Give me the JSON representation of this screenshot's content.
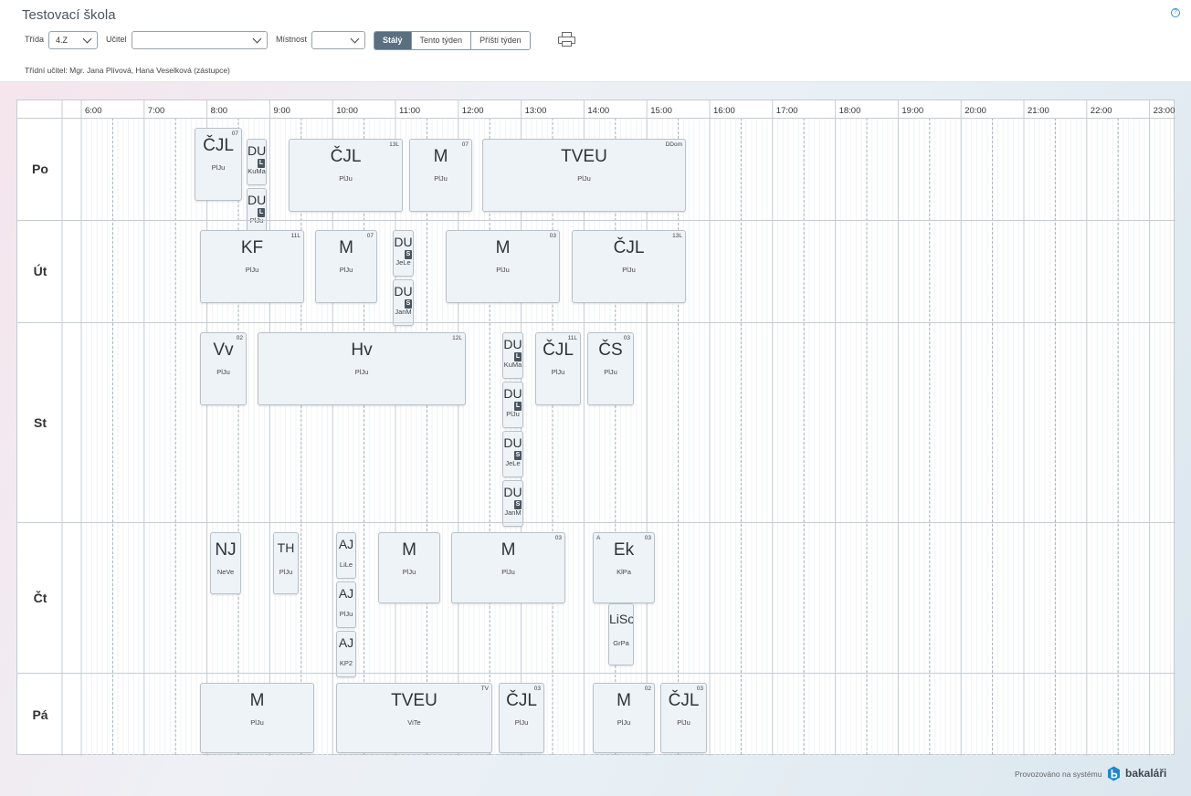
{
  "school_name": "Testovací škola",
  "help_label": "?",
  "filters": {
    "class_label": "Třída",
    "class_value": "4.Z",
    "teacher_label": "Učitel",
    "teacher_value": "",
    "room_label": "Místnost",
    "room_value": ""
  },
  "week_buttons": [
    "Stálý",
    "Tento týden",
    "Příští týden"
  ],
  "active_week": "Stálý",
  "class_teacher": "Třídní učitel: Mgr. Jana Plívová, Hana Veselková (zástupce)",
  "hours": [
    "6:00",
    "7:00",
    "8:00",
    "9:00",
    "10:00",
    "11:00",
    "12:00",
    "13:00",
    "14:00",
    "15:00",
    "16:00",
    "17:00",
    "18:00",
    "19:00",
    "20:00",
    "21:00",
    "22:00",
    "23:00"
  ],
  "days": [
    {
      "name": "Po",
      "lessons": [
        {
          "subject": "ČJL",
          "teacher": "PlJu",
          "room": "07"
        },
        {
          "subject": "DU",
          "teacher": "KuMa",
          "badge": "L"
        },
        {
          "subject": "DU",
          "teacher": "PlJu",
          "badge": "L"
        },
        {
          "subject": "ČJL",
          "teacher": "PlJu",
          "room": "13L"
        },
        {
          "subject": "M",
          "teacher": "PlJu",
          "room": "07"
        },
        {
          "subject": "TVEU",
          "teacher": "PlJu",
          "room": "DDom"
        }
      ]
    },
    {
      "name": "Út",
      "lessons": [
        {
          "subject": "KF",
          "teacher": "PlJu",
          "room": "11L"
        },
        {
          "subject": "M",
          "teacher": "PlJu",
          "room": "07"
        },
        {
          "subject": "DU",
          "teacher": "JeLe",
          "badge": "S"
        },
        {
          "subject": "DU",
          "teacher": "JanM",
          "badge": "S"
        },
        {
          "subject": "M",
          "teacher": "PlJu",
          "room": "03"
        },
        {
          "subject": "ČJL",
          "teacher": "PlJu",
          "room": "13L"
        }
      ]
    },
    {
      "name": "St",
      "lessons": [
        {
          "subject": "Vv",
          "teacher": "PlJu",
          "room": "02"
        },
        {
          "subject": "Hv",
          "teacher": "PlJu",
          "room": "12L"
        },
        {
          "subject": "DU",
          "teacher": "KuMa",
          "badge": "L"
        },
        {
          "subject": "DU",
          "teacher": "PlJu",
          "badge": "L"
        },
        {
          "subject": "DU",
          "teacher": "JeLe",
          "badge": "S"
        },
        {
          "subject": "DU",
          "teacher": "JanM",
          "badge": "S"
        },
        {
          "subject": "ČJL",
          "teacher": "PlJu",
          "room": "11L"
        },
        {
          "subject": "ČS",
          "teacher": "PlJu",
          "room": "03"
        }
      ]
    },
    {
      "name": "Čt",
      "lessons": [
        {
          "subject": "NJ",
          "teacher": "NeVe"
        },
        {
          "subject": "TH",
          "teacher": "PlJu"
        },
        {
          "subject": "AJ",
          "teacher": "LiLe"
        },
        {
          "subject": "AJ",
          "teacher": "PlJu"
        },
        {
          "subject": "AJ",
          "teacher": "KP2"
        },
        {
          "subject": "M",
          "teacher": "PlJu"
        },
        {
          "subject": "M",
          "teacher": "PlJu",
          "room": "03"
        },
        {
          "subject": "Ek",
          "teacher": "KlPa",
          "room": "03",
          "group": "A"
        },
        {
          "subject": "LiSo",
          "teacher": "GrPa"
        }
      ]
    },
    {
      "name": "Pá",
      "lessons": [
        {
          "subject": "M",
          "teacher": "PlJu"
        },
        {
          "subject": "TVEU",
          "teacher": "ViTe",
          "room": "TV"
        },
        {
          "subject": "ČJL",
          "teacher": "PlJu",
          "room": "03"
        },
        {
          "subject": "M",
          "teacher": "PlJu",
          "room": "02"
        },
        {
          "subject": "ČJL",
          "teacher": "PlJu",
          "room": "03"
        }
      ]
    }
  ],
  "footer": {
    "text": "Provozováno na systému",
    "brand": "bakaláři"
  }
}
